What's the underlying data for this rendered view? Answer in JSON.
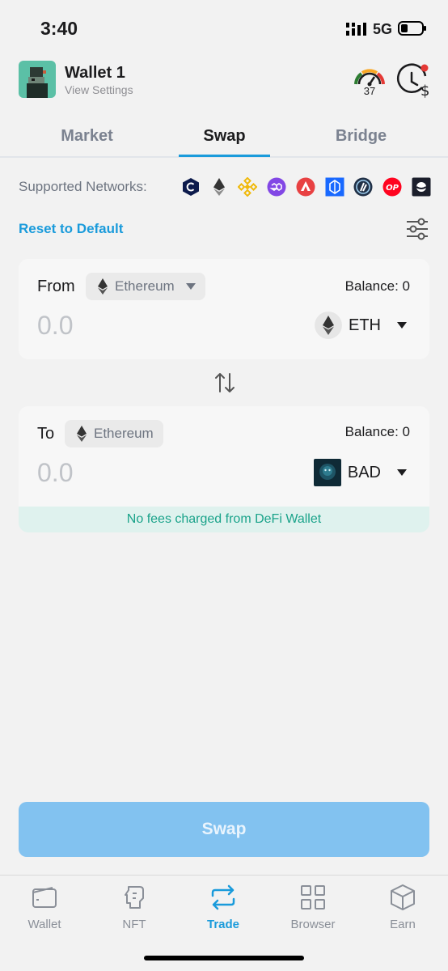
{
  "status_bar": {
    "time": "3:40",
    "network": "5G"
  },
  "header": {
    "wallet_name": "Wallet 1",
    "subtitle": "View Settings",
    "gauge_value": "37"
  },
  "tabs": [
    {
      "label": "Market",
      "active": false
    },
    {
      "label": "Swap",
      "active": true
    },
    {
      "label": "Bridge",
      "active": false
    }
  ],
  "networks": {
    "label": "Supported Networks:",
    "icons": [
      "cronos-icon",
      "ethereum-icon",
      "bnb-icon",
      "polygon-icon",
      "avalanche-icon",
      "fantom-icon",
      "arbitrum-icon",
      "optimism-icon",
      "cosmos-icon"
    ],
    "optimism_text": "OP"
  },
  "reset_label": "Reset to Default",
  "from": {
    "label": "From",
    "chain": "Ethereum",
    "balance": "Balance: 0",
    "amount_placeholder": "0.0",
    "token": "ETH"
  },
  "to": {
    "label": "To",
    "chain": "Ethereum",
    "balance": "Balance: 0",
    "amount_placeholder": "0.0",
    "token": "BAD"
  },
  "fees_note": "No fees charged from DeFi Wallet",
  "swap_button": "Swap",
  "nav": [
    {
      "label": "Wallet",
      "icon": "wallet-icon",
      "active": false
    },
    {
      "label": "NFT",
      "icon": "nft-icon",
      "active": false
    },
    {
      "label": "Trade",
      "icon": "trade-icon",
      "active": true
    },
    {
      "label": "Browser",
      "icon": "browser-icon",
      "active": false
    },
    {
      "label": "Earn",
      "icon": "earn-icon",
      "active": false
    }
  ],
  "colors": {
    "accent": "#1a9bdb",
    "swap_button": "#82c2f0",
    "fees_bg": "#dff2ee",
    "fees_text": "#1aa38a",
    "notification": "#e53935"
  }
}
